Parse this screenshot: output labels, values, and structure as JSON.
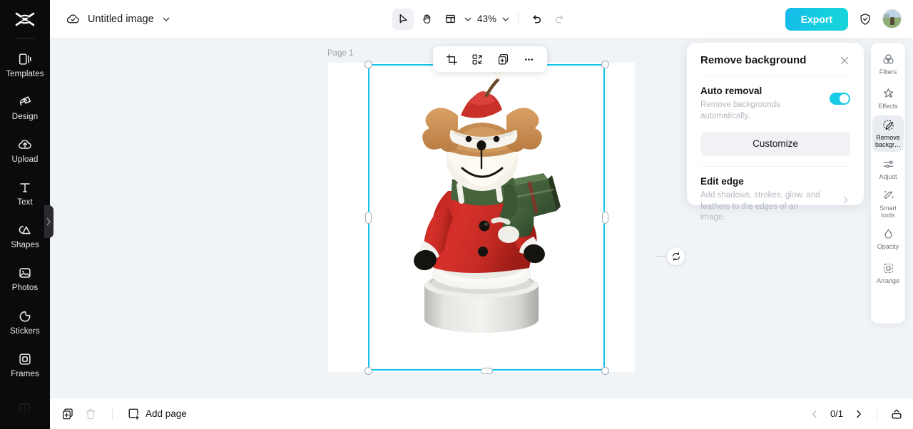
{
  "app": {
    "brand_icon": "capcut-logo",
    "accent_color": "#17cbe4",
    "selection_color": "#12c2e9"
  },
  "sidebar": {
    "items": [
      {
        "label": "Templates",
        "icon": "templates-icon"
      },
      {
        "label": "Design",
        "icon": "design-icon"
      },
      {
        "label": "Upload",
        "icon": "upload-cloud-icon"
      },
      {
        "label": "Text",
        "icon": "text-icon"
      },
      {
        "label": "Shapes",
        "icon": "shapes-icon"
      },
      {
        "label": "Photos",
        "icon": "photos-icon"
      },
      {
        "label": "Stickers",
        "icon": "stickers-icon"
      },
      {
        "label": "Frames",
        "icon": "frames-icon"
      }
    ],
    "collapse_icon": "chevron-right-icon"
  },
  "topbar": {
    "cloud_icon": "cloud-saved-icon",
    "doc_title": "Untitled image",
    "title_chevron": "chevron-down-icon",
    "tools": [
      {
        "name": "select-tool",
        "icon": "cursor-icon",
        "active": true
      },
      {
        "name": "hand-tool",
        "icon": "hand-icon",
        "active": false
      },
      {
        "name": "layout-tool",
        "icon": "layout-icon",
        "active": false
      }
    ],
    "layout_chevron": "chevron-down-icon",
    "zoom_level": "43%",
    "zoom_chevron": "chevron-down-icon",
    "undo_icon": "undo-icon",
    "redo_icon": "redo-icon",
    "redo_disabled": true,
    "export_label": "Export",
    "shield_icon": "shield-check-icon",
    "avatar_icon": "user-avatar"
  },
  "canvas": {
    "page_label": "Page 1",
    "artwork_alt": "christmas-reindeer-candle",
    "float_toolbar": [
      {
        "name": "crop-button",
        "icon": "crop-icon"
      },
      {
        "name": "replace-button",
        "icon": "replace-icon"
      },
      {
        "name": "duplicate-button",
        "icon": "duplicate-icon"
      },
      {
        "name": "more-options-button",
        "icon": "more-horizontal-icon"
      }
    ],
    "rotate_icon": "rotate-icon"
  },
  "panel": {
    "title": "Remove background",
    "close_icon": "close-icon",
    "auto_removal": {
      "title": "Auto removal",
      "description": "Remove backgrounds automatically.",
      "toggle_on": true
    },
    "customize_label": "Customize",
    "edit_edge": {
      "title": "Edit edge",
      "description": "Add shadows, strokes, glow, and feathers to the edges of an image.",
      "chevron": "chevron-right-icon"
    }
  },
  "right_rail": {
    "items": [
      {
        "label": "Filters",
        "icon": "filters-icon",
        "active": false
      },
      {
        "label": "Effects",
        "icon": "effects-icon",
        "active": false
      },
      {
        "label": "Remove backgr…",
        "icon": "remove-background-icon",
        "active": true
      },
      {
        "label": "Adjust",
        "icon": "adjust-icon",
        "active": false
      },
      {
        "label": "Smart tools",
        "icon": "smart-tools-icon",
        "active": false
      },
      {
        "label": "Opacity",
        "icon": "opacity-icon",
        "active": false
      },
      {
        "label": "Arrange",
        "icon": "arrange-icon",
        "active": false
      }
    ]
  },
  "bottombar": {
    "duplicate_page_icon": "duplicate-page-icon",
    "delete_page_icon": "trash-icon",
    "add_page_icon": "add-page-icon",
    "add_page_label": "Add page",
    "prev_icon": "chevron-left-icon",
    "page_indicator": "0/1",
    "next_icon": "chevron-right-icon",
    "expand_icon": "expand-panel-icon"
  }
}
